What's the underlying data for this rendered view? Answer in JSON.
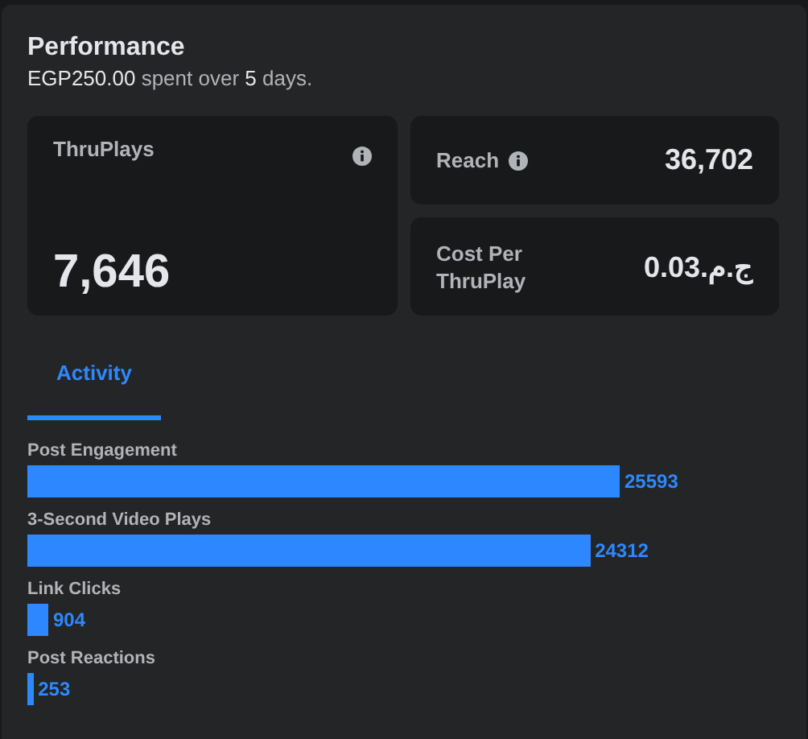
{
  "title": "Performance",
  "subtitle": "**EGP250.00** spent over **5** days.",
  "metrics": [
    {
      "label": "ThruPlays",
      "value": "7,646",
      "info": true
    },
    {
      "label": "Reach",
      "value": "36,702",
      "info": true
    },
    {
      "label": "Cost Per ThruPlay",
      "value": "ج.م.0.03",
      "info": false
    }
  ],
  "tabs": [
    {
      "label": "Activity",
      "selected": true
    }
  ],
  "activity": [
    {
      "name": "Post Engagement",
      "reading": "25593"
    },
    {
      "name": "3-Second Video Plays",
      "reading": "24312"
    },
    {
      "name": "Link Clicks",
      "reading": "904"
    },
    {
      "name": "Post Reactions",
      "reading": "253"
    }
  ]
}
